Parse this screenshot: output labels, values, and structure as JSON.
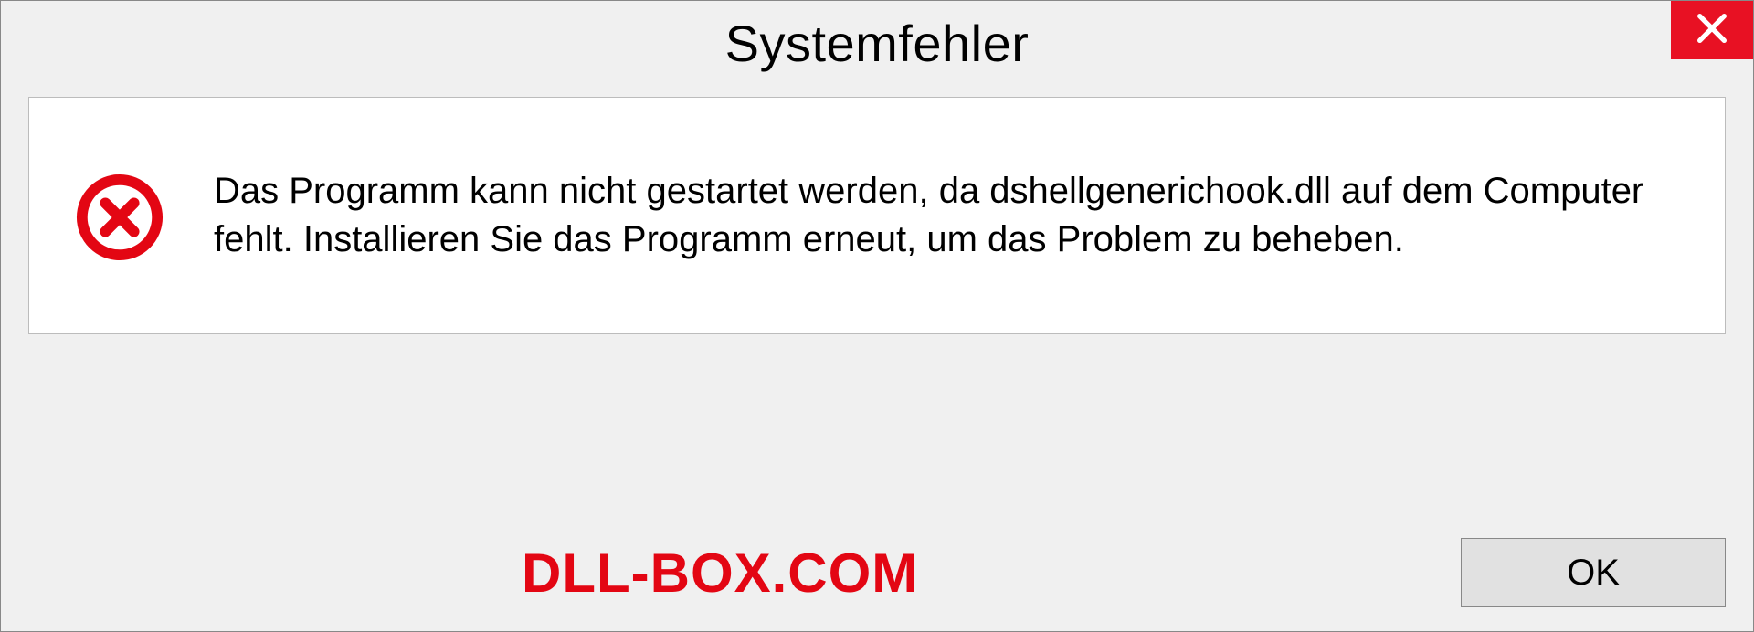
{
  "dialog": {
    "title": "Systemfehler",
    "message": "Das Programm kann nicht gestartet werden, da dshellgenerichook.dll auf dem Computer fehlt. Installieren Sie das Programm erneut, um das Problem zu beheben.",
    "okLabel": "OK"
  },
  "watermark": "DLL-BOX.COM",
  "colors": {
    "closeButton": "#e81123",
    "errorIcon": "#e30613",
    "watermarkText": "#e30613"
  }
}
